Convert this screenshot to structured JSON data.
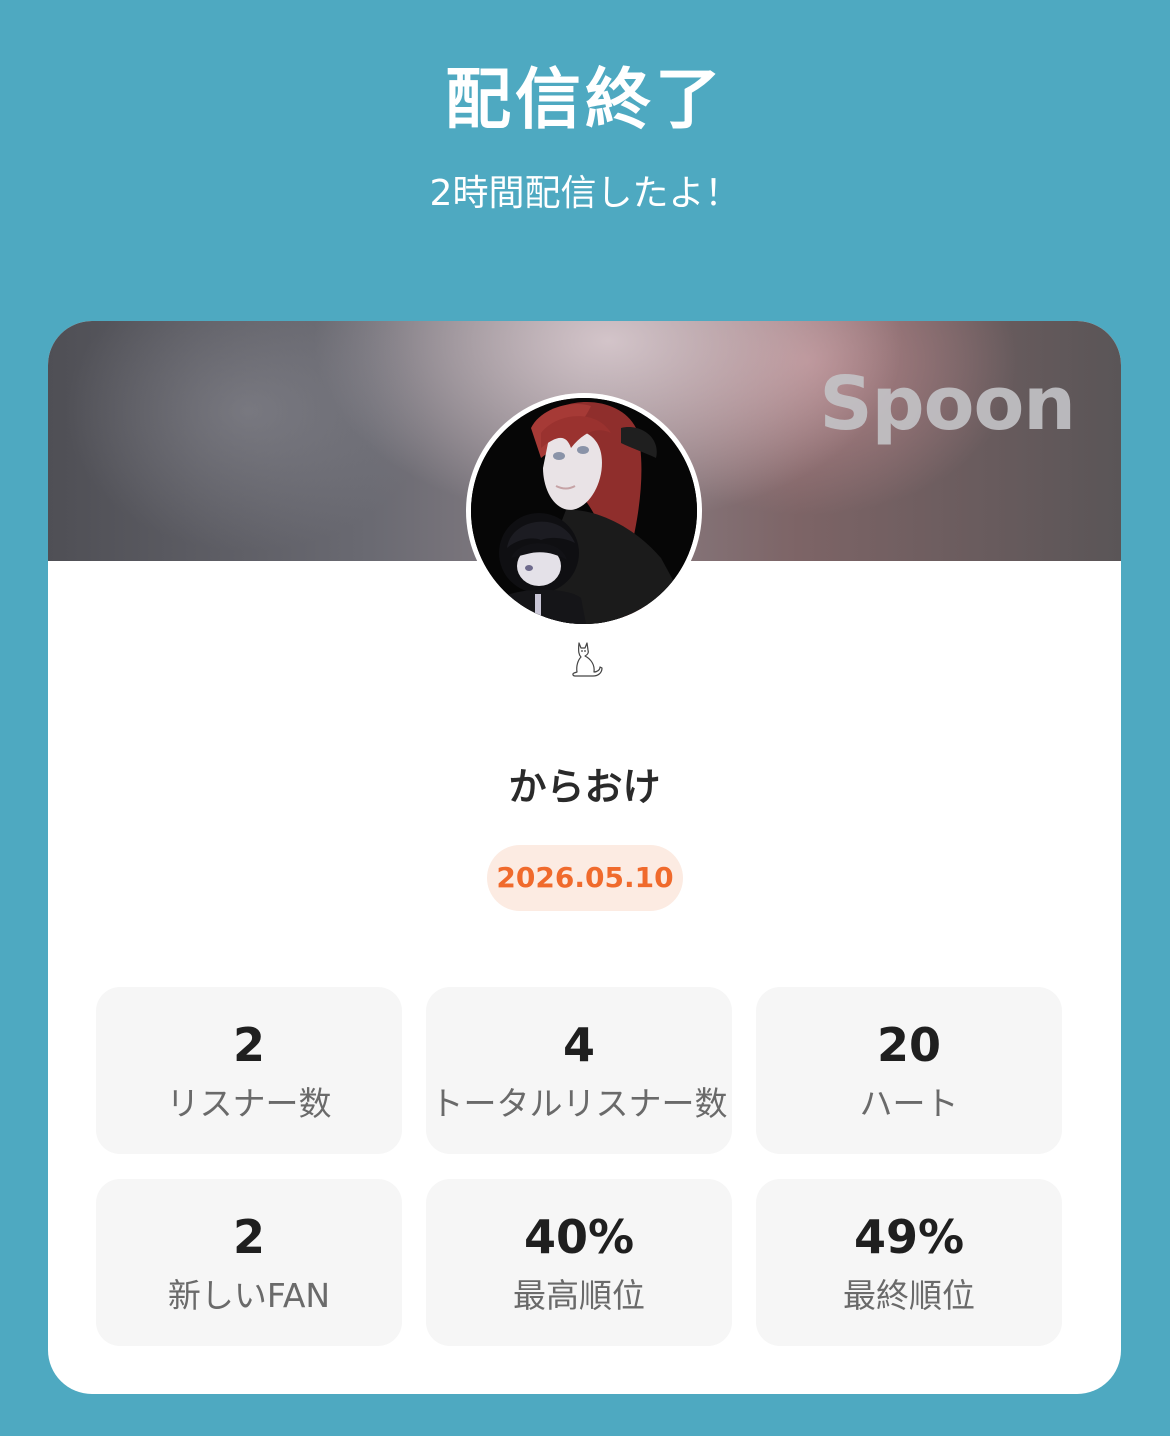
{
  "header": {
    "title": "配信終了",
    "subtitle": "2時間配信したよ！"
  },
  "card": {
    "brand": "Spoon",
    "avatar_icon": "profile-avatar",
    "badge_icon": "cat-icon",
    "name": "からおけ",
    "date": "2026.05.10",
    "stats": [
      {
        "value": "2",
        "label": "リスナー数"
      },
      {
        "value": "4",
        "label": "トータルリスナー数"
      },
      {
        "value": "20",
        "label": "ハート"
      },
      {
        "value": "2",
        "label": "新しいFAN"
      },
      {
        "value": "40%",
        "label": "最高順位"
      },
      {
        "value": "49%",
        "label": "最終順位"
      }
    ]
  },
  "colors": {
    "background": "#4ea9c1",
    "date_text": "#f06a2c",
    "date_bg": "#fcebe2",
    "stat_bg": "#f6f6f6"
  }
}
